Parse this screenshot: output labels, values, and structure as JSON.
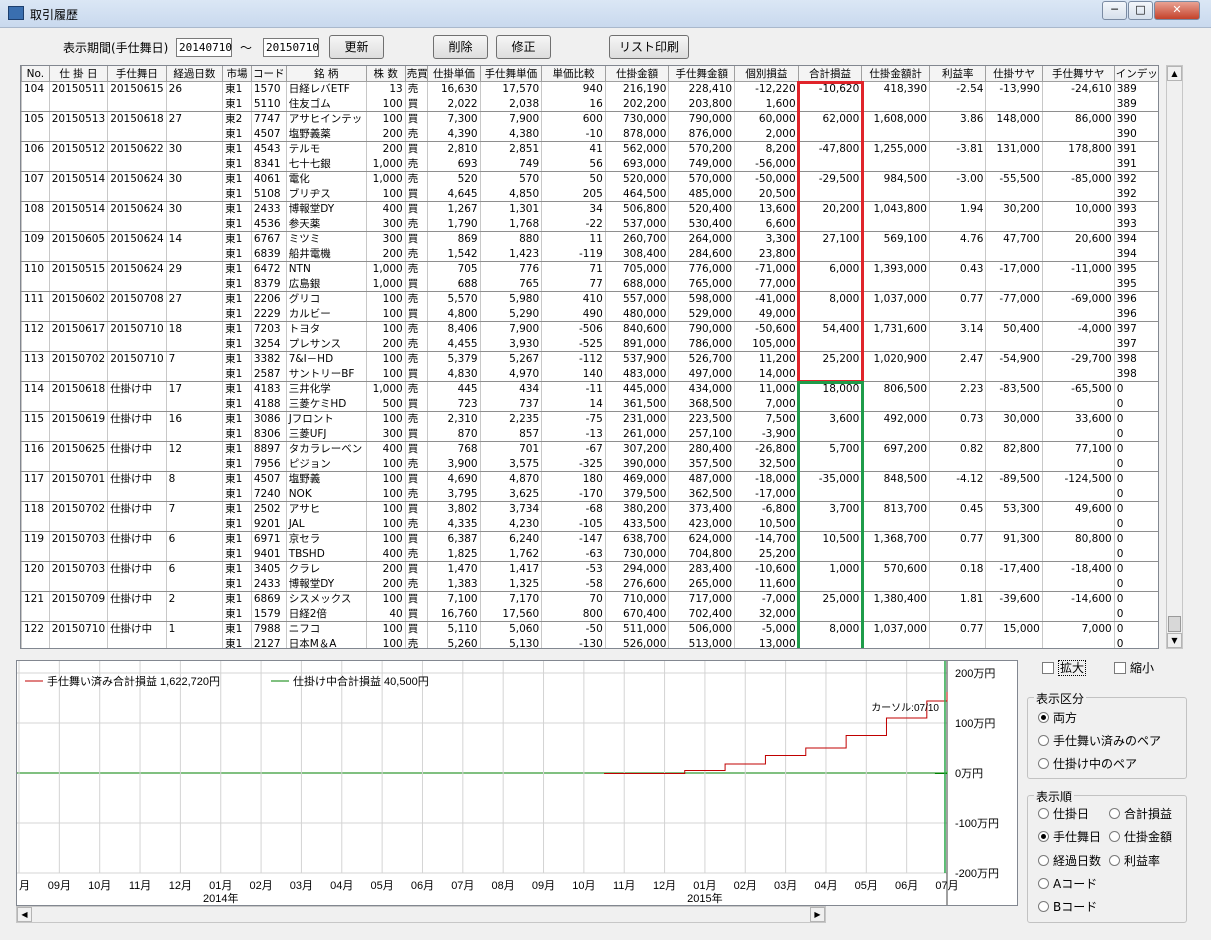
{
  "window": {
    "title": "取引履歴",
    "min": "─",
    "max": "□",
    "close": "✕"
  },
  "toolbar": {
    "period_label": "表示期間(手仕舞日)",
    "date_from": "20140710",
    "tilde": "～",
    "date_to": "20150710",
    "refresh": "更新",
    "delete": "削除",
    "edit": "修正",
    "print": "リスト印刷"
  },
  "table": {
    "columns": [
      "No.",
      "仕 掛 日",
      "手仕舞日",
      "経過日数",
      "市場",
      "コード",
      "銘 柄",
      "株 数",
      "売買",
      "仕掛単価",
      "手仕舞単価",
      "単価比較",
      "仕掛金額",
      "手仕舞金額",
      "個別損益",
      "合計損益",
      "仕掛金額計",
      "利益率",
      "仕掛サヤ",
      "手仕舞サヤ",
      "インデックス"
    ],
    "rows": [
      [
        "104",
        "20150511",
        "20150615",
        "26",
        "東1",
        "1570",
        "日経レバETF",
        "13",
        "売",
        "16,630",
        "17,570",
        "940",
        "216,190",
        "228,410",
        "-12,220",
        "-10,620",
        "418,390",
        "-2.54",
        "-13,990",
        "-24,610",
        "389"
      ],
      [
        "",
        "",
        "",
        "",
        "東1",
        "5110",
        "住友ゴム",
        "100",
        "買",
        "2,022",
        "2,038",
        "16",
        "202,200",
        "203,800",
        "1,600",
        "",
        "",
        "",
        "",
        "",
        "389"
      ],
      [
        "105",
        "20150513",
        "20150618",
        "27",
        "東2",
        "7747",
        "アサヒインテッ",
        "100",
        "買",
        "7,300",
        "7,900",
        "600",
        "730,000",
        "790,000",
        "60,000",
        "62,000",
        "1,608,000",
        "3.86",
        "148,000",
        "86,000",
        "390"
      ],
      [
        "",
        "",
        "",
        "",
        "東1",
        "4507",
        "塩野義薬",
        "200",
        "売",
        "4,390",
        "4,380",
        "-10",
        "878,000",
        "876,000",
        "2,000",
        "",
        "",
        "",
        "",
        "",
        "390"
      ],
      [
        "106",
        "20150512",
        "20150622",
        "30",
        "東1",
        "4543",
        "テルモ",
        "200",
        "買",
        "2,810",
        "2,851",
        "41",
        "562,000",
        "570,200",
        "8,200",
        "-47,800",
        "1,255,000",
        "-3.81",
        "131,000",
        "178,800",
        "391"
      ],
      [
        "",
        "",
        "",
        "",
        "東1",
        "8341",
        "七十七銀",
        "1,000",
        "売",
        "693",
        "749",
        "56",
        "693,000",
        "749,000",
        "-56,000",
        "",
        "",
        "",
        "",
        "",
        "391"
      ],
      [
        "107",
        "20150514",
        "20150624",
        "30",
        "東1",
        "4061",
        "電化",
        "1,000",
        "売",
        "520",
        "570",
        "50",
        "520,000",
        "570,000",
        "-50,000",
        "-29,500",
        "984,500",
        "-3.00",
        "-55,500",
        "-85,000",
        "392"
      ],
      [
        "",
        "",
        "",
        "",
        "東1",
        "5108",
        "ブリヂス",
        "100",
        "買",
        "4,645",
        "4,850",
        "205",
        "464,500",
        "485,000",
        "20,500",
        "",
        "",
        "",
        "",
        "",
        "392"
      ],
      [
        "108",
        "20150514",
        "20150624",
        "30",
        "東1",
        "2433",
        "博報堂DY",
        "400",
        "買",
        "1,267",
        "1,301",
        "34",
        "506,800",
        "520,400",
        "13,600",
        "20,200",
        "1,043,800",
        "1.94",
        "30,200",
        "10,000",
        "393"
      ],
      [
        "",
        "",
        "",
        "",
        "東1",
        "4536",
        "参天薬",
        "300",
        "売",
        "1,790",
        "1,768",
        "-22",
        "537,000",
        "530,400",
        "6,600",
        "",
        "",
        "",
        "",
        "",
        "393"
      ],
      [
        "109",
        "20150605",
        "20150624",
        "14",
        "東1",
        "6767",
        "ミツミ",
        "300",
        "買",
        "869",
        "880",
        "11",
        "260,700",
        "264,000",
        "3,300",
        "27,100",
        "569,100",
        "4.76",
        "47,700",
        "20,600",
        "394"
      ],
      [
        "",
        "",
        "",
        "",
        "東1",
        "6839",
        "船井電機",
        "200",
        "売",
        "1,542",
        "1,423",
        "-119",
        "308,400",
        "284,600",
        "23,800",
        "",
        "",
        "",
        "",
        "",
        "394"
      ],
      [
        "110",
        "20150515",
        "20150624",
        "29",
        "東1",
        "6472",
        "NTN",
        "1,000",
        "売",
        "705",
        "776",
        "71",
        "705,000",
        "776,000",
        "-71,000",
        "6,000",
        "1,393,000",
        "0.43",
        "-17,000",
        "-11,000",
        "395"
      ],
      [
        "",
        "",
        "",
        "",
        "東1",
        "8379",
        "広島銀",
        "1,000",
        "買",
        "688",
        "765",
        "77",
        "688,000",
        "765,000",
        "77,000",
        "",
        "",
        "",
        "",
        "",
        "395"
      ],
      [
        "111",
        "20150602",
        "20150708",
        "27",
        "東1",
        "2206",
        "グリコ",
        "100",
        "売",
        "5,570",
        "5,980",
        "410",
        "557,000",
        "598,000",
        "-41,000",
        "8,000",
        "1,037,000",
        "0.77",
        "-77,000",
        "-69,000",
        "396"
      ],
      [
        "",
        "",
        "",
        "",
        "東1",
        "2229",
        "カルビー",
        "100",
        "買",
        "4,800",
        "5,290",
        "490",
        "480,000",
        "529,000",
        "49,000",
        "",
        "",
        "",
        "",
        "",
        "396"
      ],
      [
        "112",
        "20150617",
        "20150710",
        "18",
        "東1",
        "7203",
        "トヨタ",
        "100",
        "売",
        "8,406",
        "7,900",
        "-506",
        "840,600",
        "790,000",
        "-50,600",
        "54,400",
        "1,731,600",
        "3.14",
        "50,400",
        "-4,000",
        "397"
      ],
      [
        "",
        "",
        "",
        "",
        "東1",
        "3254",
        "プレサンス",
        "200",
        "売",
        "4,455",
        "3,930",
        "-525",
        "891,000",
        "786,000",
        "105,000",
        "",
        "",
        "",
        "",
        "",
        "397"
      ],
      [
        "113",
        "20150702",
        "20150710",
        "7",
        "東1",
        "3382",
        "7&I－HD",
        "100",
        "売",
        "5,379",
        "5,267",
        "-112",
        "537,900",
        "526,700",
        "11,200",
        "25,200",
        "1,020,900",
        "2.47",
        "-54,900",
        "-29,700",
        "398"
      ],
      [
        "",
        "",
        "",
        "",
        "東1",
        "2587",
        "サントリーBF",
        "100",
        "買",
        "4,830",
        "4,970",
        "140",
        "483,000",
        "497,000",
        "14,000",
        "",
        "",
        "",
        "",
        "",
        "398"
      ],
      [
        "114",
        "20150618",
        "仕掛け中",
        "17",
        "東1",
        "4183",
        "三井化学",
        "1,000",
        "売",
        "445",
        "434",
        "-11",
        "445,000",
        "434,000",
        "11,000",
        "18,000",
        "806,500",
        "2.23",
        "-83,500",
        "-65,500",
        "0"
      ],
      [
        "",
        "",
        "",
        "",
        "東1",
        "4188",
        "三菱ケミHD",
        "500",
        "買",
        "723",
        "737",
        "14",
        "361,500",
        "368,500",
        "7,000",
        "",
        "",
        "",
        "",
        "",
        "0"
      ],
      [
        "115",
        "20150619",
        "仕掛け中",
        "16",
        "東1",
        "3086",
        "Jフロント",
        "100",
        "売",
        "2,310",
        "2,235",
        "-75",
        "231,000",
        "223,500",
        "7,500",
        "3,600",
        "492,000",
        "0.73",
        "30,000",
        "33,600",
        "0"
      ],
      [
        "",
        "",
        "",
        "",
        "東1",
        "8306",
        "三菱UFJ",
        "300",
        "買",
        "870",
        "857",
        "-13",
        "261,000",
        "257,100",
        "-3,900",
        "",
        "",
        "",
        "",
        "",
        "0"
      ],
      [
        "116",
        "20150625",
        "仕掛け中",
        "12",
        "東1",
        "8897",
        "タカラレーベン",
        "400",
        "買",
        "768",
        "701",
        "-67",
        "307,200",
        "280,400",
        "-26,800",
        "5,700",
        "697,200",
        "0.82",
        "82,800",
        "77,100",
        "0"
      ],
      [
        "",
        "",
        "",
        "",
        "東1",
        "7956",
        "ピジョン",
        "100",
        "売",
        "3,900",
        "3,575",
        "-325",
        "390,000",
        "357,500",
        "32,500",
        "",
        "",
        "",
        "",
        "",
        "0"
      ],
      [
        "117",
        "20150701",
        "仕掛け中",
        "8",
        "東1",
        "4507",
        "塩野義",
        "100",
        "買",
        "4,690",
        "4,870",
        "180",
        "469,000",
        "487,000",
        "-18,000",
        "-35,000",
        "848,500",
        "-4.12",
        "-89,500",
        "-124,500",
        "0"
      ],
      [
        "",
        "",
        "",
        "",
        "東1",
        "7240",
        "NOK",
        "100",
        "売",
        "3,795",
        "3,625",
        "-170",
        "379,500",
        "362,500",
        "-17,000",
        "",
        "",
        "",
        "",
        "",
        "0"
      ],
      [
        "118",
        "20150702",
        "仕掛け中",
        "7",
        "東1",
        "2502",
        "アサヒ",
        "100",
        "買",
        "3,802",
        "3,734",
        "-68",
        "380,200",
        "373,400",
        "-6,800",
        "3,700",
        "813,700",
        "0.45",
        "53,300",
        "49,600",
        "0"
      ],
      [
        "",
        "",
        "",
        "",
        "東1",
        "9201",
        "JAL",
        "100",
        "売",
        "4,335",
        "4,230",
        "-105",
        "433,500",
        "423,000",
        "10,500",
        "",
        "",
        "",
        "",
        "",
        "0"
      ],
      [
        "119",
        "20150703",
        "仕掛け中",
        "6",
        "東1",
        "6971",
        "京セラ",
        "100",
        "買",
        "6,387",
        "6,240",
        "-147",
        "638,700",
        "624,000",
        "-14,700",
        "10,500",
        "1,368,700",
        "0.77",
        "91,300",
        "80,800",
        "0"
      ],
      [
        "",
        "",
        "",
        "",
        "東1",
        "9401",
        "TBSHD",
        "400",
        "売",
        "1,825",
        "1,762",
        "-63",
        "730,000",
        "704,800",
        "25,200",
        "",
        "",
        "",
        "",
        "",
        "0"
      ],
      [
        "120",
        "20150703",
        "仕掛け中",
        "6",
        "東1",
        "3405",
        "クラレ",
        "200",
        "買",
        "1,470",
        "1,417",
        "-53",
        "294,000",
        "283,400",
        "-10,600",
        "1,000",
        "570,600",
        "0.18",
        "-17,400",
        "-18,400",
        "0"
      ],
      [
        "",
        "",
        "",
        "",
        "東1",
        "2433",
        "博報堂DY",
        "200",
        "売",
        "1,383",
        "1,325",
        "-58",
        "276,600",
        "265,000",
        "11,600",
        "",
        "",
        "",
        "",
        "",
        "0"
      ],
      [
        "121",
        "20150709",
        "仕掛け中",
        "2",
        "東1",
        "6869",
        "シスメックス",
        "100",
        "買",
        "7,100",
        "7,170",
        "70",
        "710,000",
        "717,000",
        "-7,000",
        "25,000",
        "1,380,400",
        "1.81",
        "-39,600",
        "-14,600",
        "0"
      ],
      [
        "",
        "",
        "",
        "",
        "東1",
        "1579",
        "日経2倍",
        "40",
        "買",
        "16,760",
        "17,560",
        "800",
        "670,400",
        "702,400",
        "32,000",
        "",
        "",
        "",
        "",
        "",
        "0"
      ],
      [
        "122",
        "20150710",
        "仕掛け中",
        "1",
        "東1",
        "7988",
        "ニフコ",
        "100",
        "買",
        "5,110",
        "5,060",
        "-50",
        "511,000",
        "506,000",
        "-5,000",
        "8,000",
        "1,037,000",
        "0.77",
        "15,000",
        "7,000",
        "0"
      ],
      [
        "",
        "",
        "",
        "",
        "東1",
        "2127",
        "日本M＆A",
        "100",
        "売",
        "5,260",
        "5,130",
        "-130",
        "526,000",
        "513,000",
        "13,000",
        "",
        "",
        "",
        "",
        "",
        "0"
      ]
    ]
  },
  "highlight": {
    "closed_color": "#e0242a",
    "open_color": "#1f9c4a"
  },
  "chart_data": {
    "type": "line",
    "legend_closed": "手仕舞い済み合計損益",
    "legend_closed_value": "1,622,720円",
    "legend_open": "仕掛け中合計損益",
    "legend_open_value": "40,500円",
    "cursor_label": "カーソル:07/10",
    "ylim": [
      -200,
      200
    ],
    "y_ticks": [
      "200万円",
      "100万円",
      "0万円",
      "-100万円",
      "-200万円"
    ],
    "x_ticks": [
      "月",
      "09月",
      "10月",
      "11月",
      "12月",
      "01月",
      "02月",
      "03月",
      "04月",
      "05月",
      "06月",
      "07月",
      "08月",
      "09月",
      "10月",
      "11月",
      "12月",
      "01月",
      "02月",
      "03月",
      "04月",
      "05月",
      "06月",
      "07月"
    ],
    "year_labels": [
      "2014年",
      "2015年"
    ],
    "series": [
      {
        "name": "手仕舞い済み合計損益",
        "color": "#c00000",
        "x": [
          14.5,
          15.5,
          16.5,
          17.5,
          18.5,
          19.5,
          20.5,
          21.5,
          22.5,
          23
        ],
        "y": [
          -1,
          -1,
          5,
          18,
          35,
          50,
          75,
          110,
          144,
          162
        ]
      },
      {
        "name": "仕掛け中合計損益",
        "color": "#008000",
        "x": [
          22.7,
          23
        ],
        "y": [
          -1,
          4
        ]
      }
    ],
    "closed_color": "#c00000",
    "open_color": "#008000"
  },
  "controls": {
    "zoom_in": "拡大",
    "zoom_out": "縮小",
    "display_group": "表示区分",
    "display_options": [
      "両方",
      "手仕舞い済みのペア",
      "仕掛け中のペア"
    ],
    "display_selected": 0,
    "order_group": "表示順",
    "order_options": [
      "仕掛日",
      "合計損益",
      "手仕舞日",
      "仕掛金額",
      "経過日数",
      "利益率",
      "Aコード",
      "Bコード"
    ],
    "order_selected": 2
  }
}
